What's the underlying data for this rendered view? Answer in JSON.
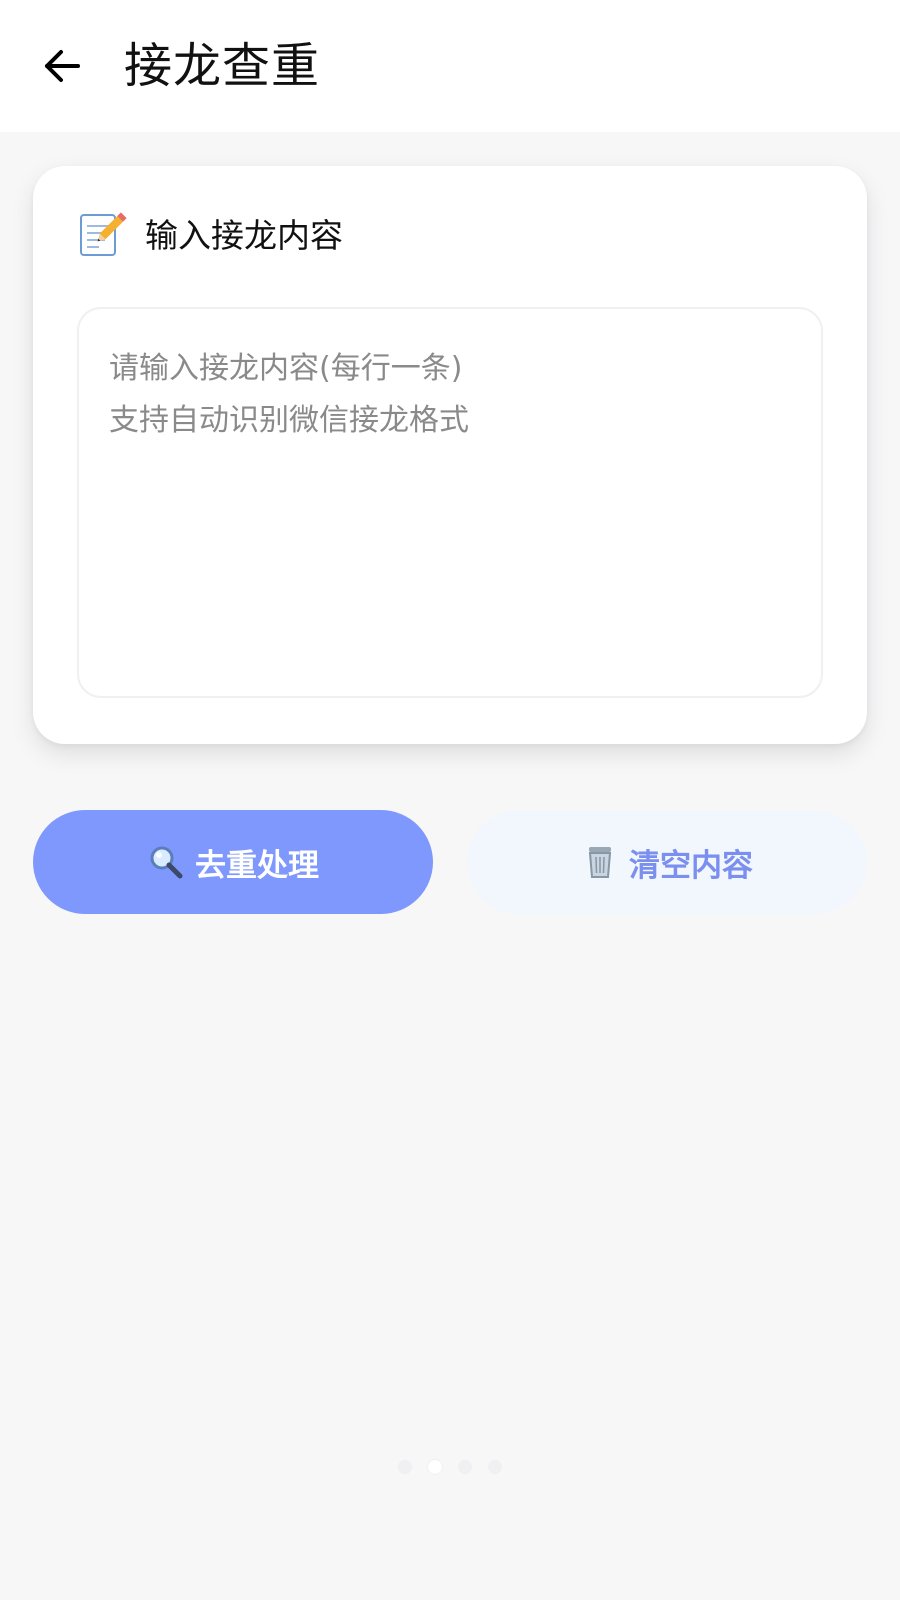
{
  "header": {
    "title": "接龙查重",
    "back_icon": "arrow-left-icon"
  },
  "input_card": {
    "icon": "memo-icon",
    "title": "输入接龙内容",
    "textarea": {
      "value": "",
      "placeholder": "请输入接龙内容(每行一条)\n支持自动识别微信接龙格式"
    }
  },
  "actions": {
    "dedupe": {
      "icon": "magnifier-icon",
      "label": "去重处理"
    },
    "clear": {
      "icon": "trash-icon",
      "label": "清空内容"
    }
  },
  "pager": {
    "count": 4,
    "active_index": 1
  },
  "colors": {
    "primary": "#7f98fd",
    "primary_light": "#f2f6fd",
    "clear_text": "#7b8fef",
    "page_bg": "#f7f7f8"
  }
}
